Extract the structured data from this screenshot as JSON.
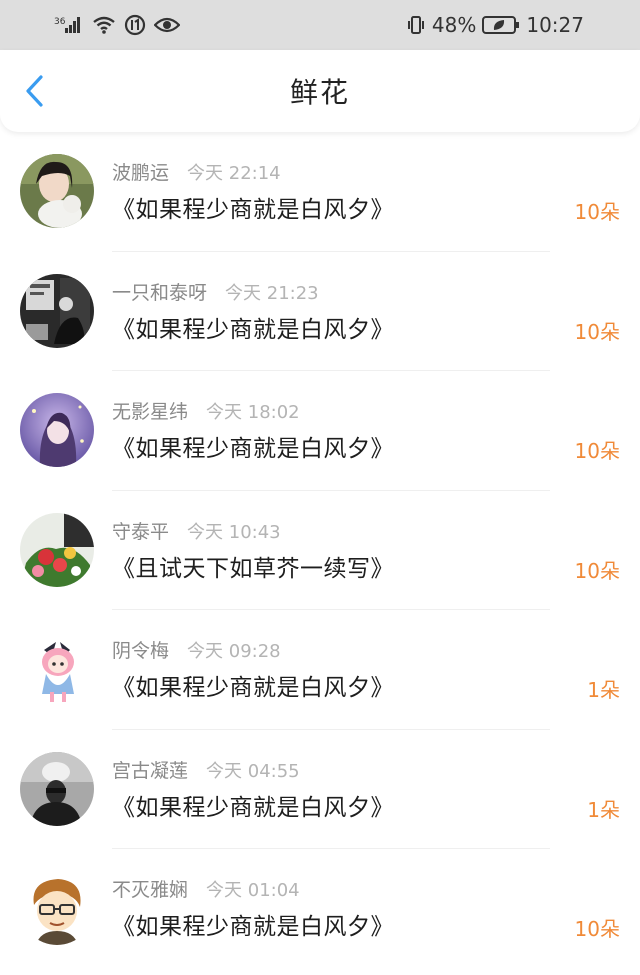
{
  "status_bar": {
    "network": "36",
    "battery": "48%",
    "time": "10:27"
  },
  "header": {
    "title": "鲜花"
  },
  "icons": {
    "back": "chevron-left-icon",
    "signal": "signal-icon",
    "wifi": "wifi-icon",
    "eye": "eye-icon",
    "vibrate": "vibrate-icon",
    "battery": "battery-icon"
  },
  "colors": {
    "accent": "#3a9cf0",
    "amount": "#f08a38",
    "status_bar_bg": "#dedede"
  },
  "items": [
    {
      "user": "波鹏运",
      "time": "今天 22:14",
      "book": "《如果程少商就是白风夕》",
      "amount": "10朵"
    },
    {
      "user": "一只和泰呀",
      "time": "今天 21:23",
      "book": "《如果程少商就是白风夕》",
      "amount": "10朵"
    },
    {
      "user": "无影星纬",
      "time": "今天 18:02",
      "book": "《如果程少商就是白风夕》",
      "amount": "10朵"
    },
    {
      "user": "守泰平",
      "time": "今天 10:43",
      "book": "《且试天下如草芥一续写》",
      "amount": "10朵"
    },
    {
      "user": "阴令梅",
      "time": "今天 09:28",
      "book": "《如果程少商就是白风夕》",
      "amount": "1朵"
    },
    {
      "user": "宫古凝莲",
      "time": "今天 04:55",
      "book": "《如果程少商就是白风夕》",
      "amount": "1朵"
    },
    {
      "user": "不灭雅娴",
      "time": "今天 01:04",
      "book": "《如果程少商就是白风夕》",
      "amount": "10朵"
    }
  ]
}
